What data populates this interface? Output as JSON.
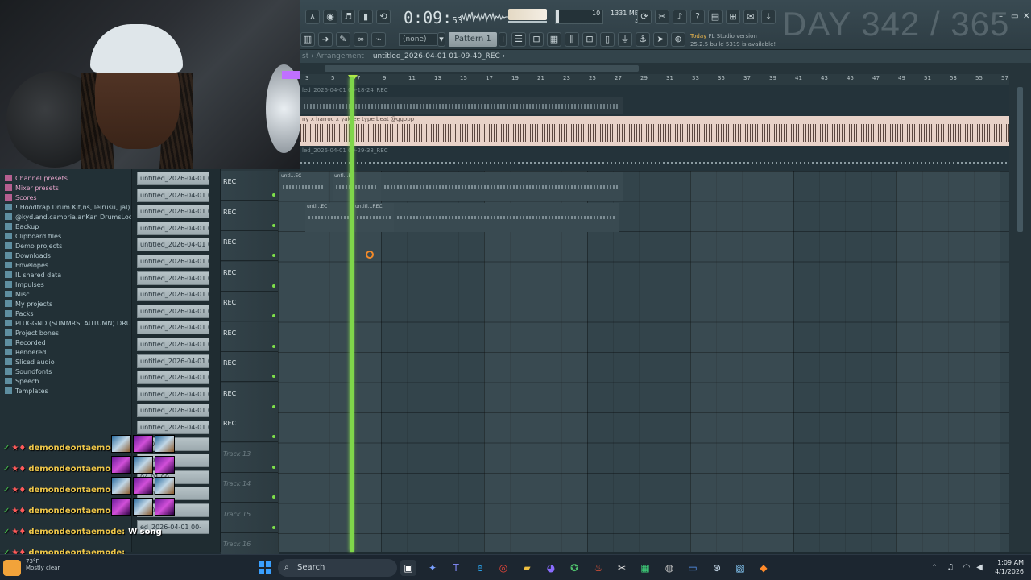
{
  "toolbar": {
    "time_main": "0:09",
    "time_sub": "53",
    "mem_num": "10",
    "mem_line1": "1331 MB",
    "mem_line2": "4",
    "pattern_select": "(none)",
    "pattern_label": "Pattern 1",
    "news_line1_prefix": "Today",
    "news_line1": "FL Studio version",
    "news_line2": "25.2.5 build 5319 is available!",
    "day_counter": "DAY 342 / 365",
    "win_min": "–",
    "win_max": "▭",
    "win_close": "✕"
  },
  "playlist": {
    "title_prefix": "st › Arrangement",
    "title": "untitled_2026-04-01 01-09-40_REC ›",
    "ruler_ticks": [
      "3",
      "5",
      "7",
      "9",
      "11",
      "13",
      "15",
      "17",
      "19",
      "21",
      "23",
      "25",
      "27",
      "29",
      "31",
      "33",
      "35",
      "37",
      "39",
      "41",
      "43",
      "45",
      "47",
      "49",
      "51",
      "53",
      "55",
      "57"
    ],
    "audio_clips": [
      {
        "name": "led_2026-04-01 00-18-24_REC"
      },
      {
        "name": "ny x harroc x yakree type beat @ggopp"
      },
      {
        "name": "led_2026-04-01 00-29-38_REC"
      }
    ],
    "tracks": [
      {
        "label": "REC"
      },
      {
        "label": "REC"
      },
      {
        "label": "REC"
      },
      {
        "label": "REC"
      },
      {
        "label": "REC"
      },
      {
        "label": "REC"
      },
      {
        "label": "REC"
      },
      {
        "label": "REC"
      },
      {
        "label": "REC"
      },
      {
        "label": "Track 13"
      },
      {
        "label": "Track 14"
      },
      {
        "label": "Track 15"
      },
      {
        "label": "Track 16"
      }
    ],
    "clip_names": {
      "c1": "untl...EC",
      "c2": "untl...EC",
      "c3": "untl...EC",
      "c4": "untitl...REC"
    }
  },
  "browser": {
    "items": [
      {
        "label": "Channel presets",
        "color": "pink"
      },
      {
        "label": "Mixer presets",
        "color": "pink"
      },
      {
        "label": "Scores",
        "color": "pink"
      },
      {
        "label": "! Hoodtrap Drum Kit,ns, leirusu, jal) (2)",
        "color": "blue"
      },
      {
        "label": "@kyd.and.cambria.anKan DrumsLoopKit",
        "color": "blue"
      },
      {
        "label": "Backup",
        "color": "blue"
      },
      {
        "label": "Clipboard files",
        "color": "blue"
      },
      {
        "label": "Demo projects",
        "color": "blue"
      },
      {
        "label": "Downloads",
        "color": "blue"
      },
      {
        "label": "Envelopes",
        "color": "blue"
      },
      {
        "label": "IL shared data",
        "color": "blue"
      },
      {
        "label": "Impulses",
        "color": "blue"
      },
      {
        "label": "Misc",
        "color": "blue"
      },
      {
        "label": "My projects",
        "color": "blue"
      },
      {
        "label": "Packs",
        "color": "blue"
      },
      {
        "label": "PLUGGND (SUMMRS, AUTUMN) DRUMKIT",
        "color": "blue"
      },
      {
        "label": "Project bones",
        "color": "blue"
      },
      {
        "label": "Recorded",
        "color": "blue"
      },
      {
        "label": "Rendered",
        "color": "blue"
      },
      {
        "label": "Sliced audio",
        "color": "blue"
      },
      {
        "label": "Soundfonts",
        "color": "blue"
      },
      {
        "label": "Speech",
        "color": "blue"
      },
      {
        "label": "Templates",
        "color": "blue"
      }
    ]
  },
  "picker": {
    "items": [
      "untitled_2026-04-01 00-",
      "untitled_2026-04-01 00-",
      "untitled_2026-04-01 00-",
      "untitled_2026-04-01 00-",
      "untitled_2026-04-01 00-",
      "untitled_2026-04-01 00-",
      "untitled_2026-04-01 00-",
      "untitled_2026-04-01 00-",
      "untitled_2026-04-01 00-",
      "untitled_2026-04-01 00-",
      "untitled_2026-04-01 00-",
      "untitled_2026-04-01 00-",
      "untitled_2026-04-01 00-",
      "untitled_2026-04-01 00-",
      "untitled_2026-04-01 00-",
      "untitled_2026-04-01 00-",
      "04-01 00-",
      "04-01 00-",
      "04-01 00-",
      "04-01 00-",
      "04-01 00-",
      "ed_2026-04-01 00-"
    ]
  },
  "chat": {
    "messages": [
      {
        "user": "demondeontaemode:",
        "text": ""
      },
      {
        "user": "demondeontaemode:",
        "text": ""
      },
      {
        "user": "demondeontaemode:",
        "text": ""
      },
      {
        "user": "demondeontaemode:",
        "text": ""
      },
      {
        "user": "demondeontaemode:",
        "text": "W song"
      },
      {
        "user": "demondeontaemode:",
        "text": ""
      }
    ]
  },
  "taskbar": {
    "weather_temp": "73°F",
    "weather_desc": "Mostly clear",
    "search_label": "Search",
    "clock_time": "1:09 AM",
    "clock_date": "4/1/2026"
  },
  "colors": {
    "playhead": "#7fd64a",
    "chat_name": "#f0c84a",
    "audio_track": "#e8d2c8"
  }
}
